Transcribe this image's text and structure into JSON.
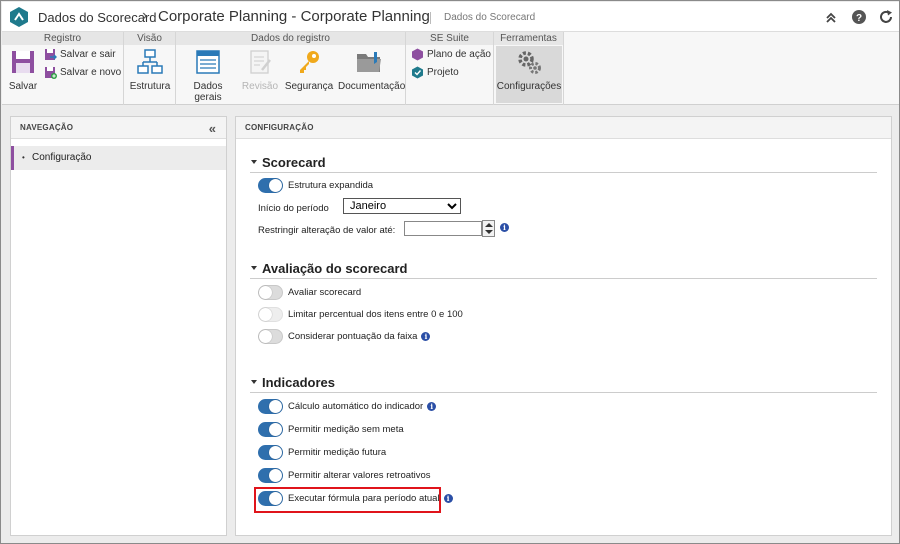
{
  "header": {
    "breadcrumb_root": "Dados do Scorecard",
    "title": "Corporate Planning - Corporate Planning",
    "subtitle": "Dados do Scorecard"
  },
  "ribbon": {
    "groups": {
      "registro": "Registro",
      "visao": "Visão",
      "dados_registro": "Dados do registro",
      "se_suite": "SE Suite",
      "ferramentas": "Ferramentas"
    },
    "buttons": {
      "salvar": "Salvar",
      "salvar_sair": "Salvar e sair",
      "salvar_novo": "Salvar e novo",
      "estrutura": "Estrutura",
      "dados_gerais": "Dados gerais",
      "revisao": "Revisão",
      "seguranca": "Segurança",
      "documentacao": "Documentação",
      "plano_acao": "Plano de ação",
      "projeto": "Projeto",
      "configuracoes": "Configurações"
    }
  },
  "nav": {
    "title": "NAVEGAÇÃO",
    "items": [
      {
        "label": "Configuração"
      }
    ]
  },
  "main": {
    "title": "CONFIGURAÇÃO",
    "scorecard": {
      "title": "Scorecard",
      "estrutura_expandida": {
        "label": "Estrutura expandida",
        "on": true
      },
      "inicio_periodo": {
        "label": "Início do período",
        "value": "Janeiro"
      },
      "restringir": {
        "label": "Restringir alteração de valor até:",
        "value": ""
      }
    },
    "avaliacao": {
      "title": "Avaliação do scorecard",
      "items": [
        {
          "label": "Avaliar scorecard",
          "on": false
        },
        {
          "label": "Limitar percentual dos itens entre 0 e 100",
          "on": false,
          "disabled": true
        },
        {
          "label": "Considerar pontuação da faixa",
          "on": false
        }
      ]
    },
    "indicadores": {
      "title": "Indicadores",
      "items": [
        {
          "label": "Cálculo automático do indicador",
          "on": true
        },
        {
          "label": "Permitir medição sem meta",
          "on": true
        },
        {
          "label": "Permitir medição futura",
          "on": true
        },
        {
          "label": "Permitir alterar valores retroativos",
          "on": true
        },
        {
          "label": "Executar fórmula para período atual",
          "on": true
        }
      ]
    }
  },
  "colors": {
    "accent": "#2f6fad",
    "nav_marker": "#8e4fa0",
    "highlight": "#e0141b",
    "logo": "#1f7a8c"
  }
}
